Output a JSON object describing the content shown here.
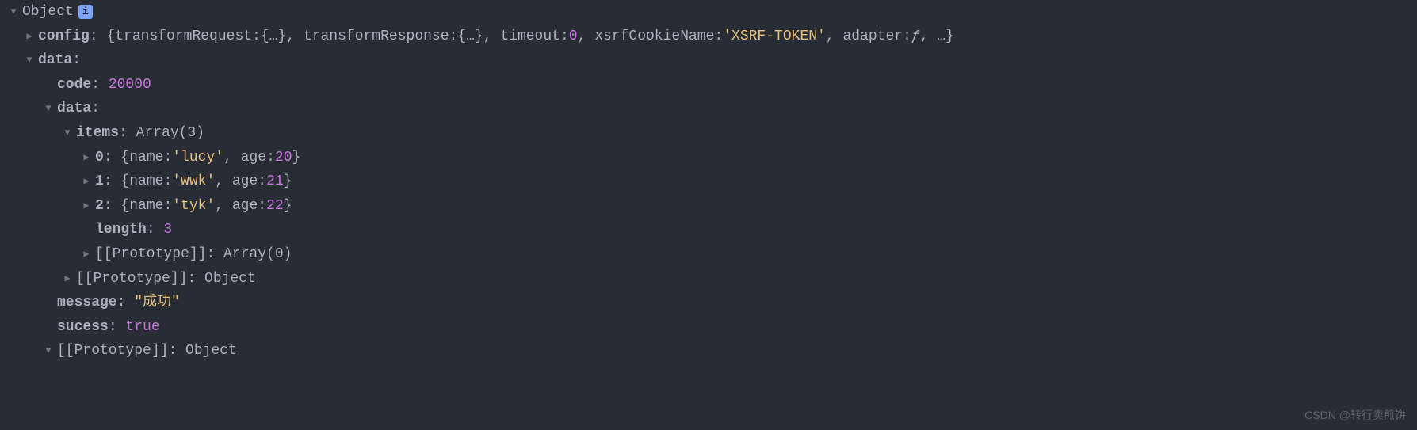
{
  "root": {
    "label": "Object"
  },
  "config": {
    "key": "config",
    "braceOpen": "{",
    "transformRequestKey": "transformRequest: ",
    "transformRequestVal": "{…}",
    "sep1": ", ",
    "transformResponseKey": "transformResponse: ",
    "transformResponseVal": "{…}",
    "sep2": ", ",
    "timeoutKey": "timeout: ",
    "timeoutVal": "0",
    "sep3": ", ",
    "xsrfKey": "xsrfCookieName: ",
    "xsrfVal": "'XSRF-TOKEN'",
    "sep4": ", ",
    "adapterKey": "adapter: ",
    "adapterVal": "ƒ",
    "sep5": ", …}",
    "colon": ": "
  },
  "dataOuter": {
    "key": "data",
    "colon": ":"
  },
  "code": {
    "key": "code",
    "colon": ": ",
    "val": "20000"
  },
  "dataInner": {
    "key": "data",
    "colon": ":"
  },
  "items": {
    "key": "items",
    "colon": ": ",
    "preview": "Array(3)"
  },
  "item0": {
    "key": "0",
    "colon": ": ",
    "braceOpen": "{",
    "nameKey": "name: ",
    "nameVal": "'lucy'",
    "sep": ", ",
    "ageKey": "age: ",
    "ageVal": "20",
    "braceClose": "}"
  },
  "item1": {
    "key": "1",
    "colon": ": ",
    "braceOpen": "{",
    "nameKey": "name: ",
    "nameVal": "'wwk'",
    "sep": ", ",
    "ageKey": "age: ",
    "ageVal": "21",
    "braceClose": "}"
  },
  "item2": {
    "key": "2",
    "colon": ": ",
    "braceOpen": "{",
    "nameKey": "name: ",
    "nameVal": "'tyk'",
    "sep": ", ",
    "ageKey": "age: ",
    "ageVal": "22",
    "braceClose": "}"
  },
  "length": {
    "key": "length",
    "colon": ": ",
    "val": "3"
  },
  "protoArray": {
    "key": "[[Prototype]]",
    "colon": ": ",
    "val": "Array(0)"
  },
  "protoObjInner": {
    "key": "[[Prototype]]",
    "colon": ": ",
    "val": "Object"
  },
  "message": {
    "key": "message",
    "colon": ": ",
    "val": "\"成功\""
  },
  "success": {
    "key": "sucess",
    "colon": ": ",
    "val": "true"
  },
  "protoObjOuter": {
    "key": "[[Prototype]]",
    "colon": ": ",
    "val": "Object"
  },
  "watermark": "CSDN @转行卖煎饼",
  "infoBadge": "i"
}
